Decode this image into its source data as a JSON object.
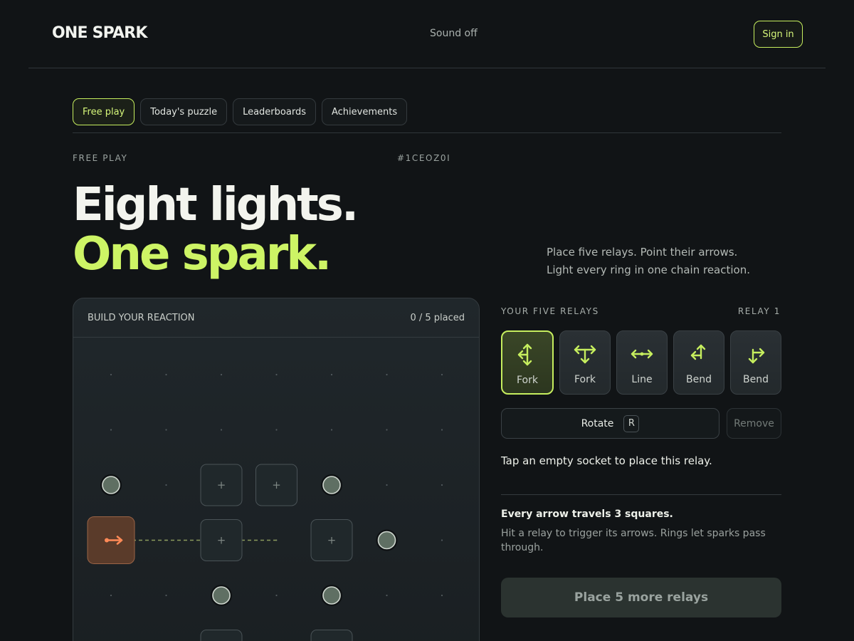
{
  "header": {
    "logo": "ONE SPARK",
    "sound_label": "Sound off",
    "signin_label": "Sign in"
  },
  "tabs": [
    {
      "label": "Free play",
      "active": true
    },
    {
      "label": "Today's puzzle",
      "active": false
    },
    {
      "label": "Leaderboards",
      "active": false
    },
    {
      "label": "Achievements",
      "active": false
    }
  ],
  "intro": {
    "eyebrow": "FREE PLAY",
    "puzzle_code": "#1CEOZ0I",
    "headline_line1": "Eight lights.",
    "headline_line2": "One spark.",
    "lead_line1": "Place five relays. Point their arrows.",
    "lead_line2": "Light every ring in one chain reaction."
  },
  "board": {
    "title": "BUILD YOUR REACTION",
    "placed_status": "0 / 5 placed",
    "grid": {
      "cols": 7,
      "rows": 6
    },
    "spark": {
      "col": 0,
      "row": 3,
      "direction": "right",
      "reach": 3
    },
    "rings": [
      {
        "col": 0,
        "row": 2
      },
      {
        "col": 4,
        "row": 2
      },
      {
        "col": 5,
        "row": 3
      },
      {
        "col": 2,
        "row": 4
      },
      {
        "col": 4,
        "row": 4
      }
    ],
    "sockets": [
      {
        "col": 2,
        "row": 2
      },
      {
        "col": 3,
        "row": 2
      },
      {
        "col": 2,
        "row": 3
      },
      {
        "col": 4,
        "row": 3
      },
      {
        "col": 2,
        "row": 5
      },
      {
        "col": 4,
        "row": 5
      }
    ],
    "socket_glyph": "+",
    "colors": {
      "accent": "#c6ee5e",
      "spark": "#ff8a57"
    }
  },
  "relays": {
    "label": "YOUR FIVE RELAYS",
    "current": "RELAY 1",
    "items": [
      {
        "name": "Fork",
        "icon": "fork-vertical-icon",
        "selected": true
      },
      {
        "name": "Fork",
        "icon": "fork-horizontal-icon",
        "selected": false
      },
      {
        "name": "Line",
        "icon": "line-horizontal-icon",
        "selected": false
      },
      {
        "name": "Bend",
        "icon": "bend-up-left-icon",
        "selected": false
      },
      {
        "name": "Bend",
        "icon": "bend-down-right-icon",
        "selected": false
      }
    ],
    "rotate_label": "Rotate",
    "rotate_key": "R",
    "remove_label": "Remove",
    "hint": "Tap an empty socket to place this relay."
  },
  "rules": {
    "title": "Every arrow travels 3 squares.",
    "body": "Hit a relay to trigger its arrows. Rings let sparks pass through."
  },
  "cta_label": "Place 5 more relays"
}
